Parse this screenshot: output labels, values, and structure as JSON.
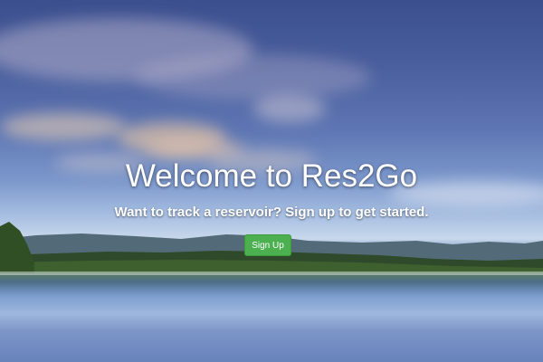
{
  "hero": {
    "title": "Welcome to Res2Go",
    "subtitle": "Want to track a reservoir? Sign up to get started.",
    "cta_label": "Sign Up"
  },
  "colors": {
    "cta_background": "#4caf50",
    "text": "#ffffff"
  }
}
